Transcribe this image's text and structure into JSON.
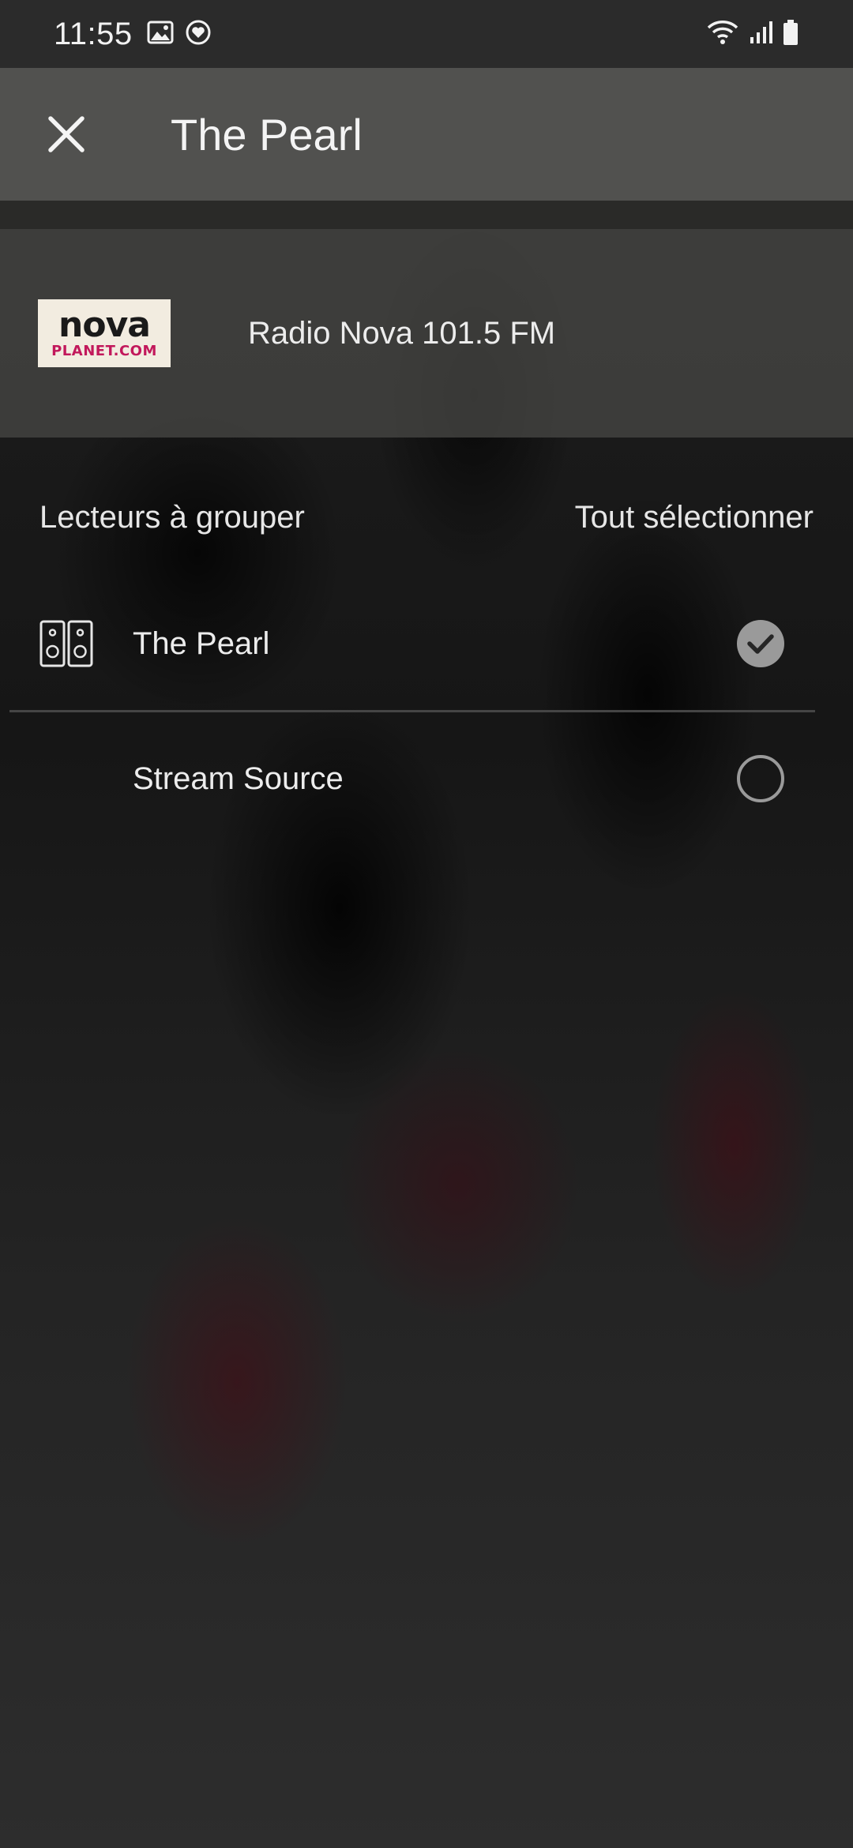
{
  "status_bar": {
    "time": "11:55",
    "left_icons": [
      "image-icon",
      "heart-circle-icon"
    ],
    "right_icons": [
      "wifi-icon",
      "signal-icon",
      "battery-icon"
    ]
  },
  "app_bar": {
    "close_icon": "close-icon",
    "title": "The Pearl"
  },
  "station": {
    "logo_text_top": "nova",
    "logo_text_bottom": "PLANET.COM",
    "name": "Radio Nova 101.5 FM"
  },
  "group_section": {
    "title": "Lecteurs à grouper",
    "select_all_label": "Tout sélectionner"
  },
  "players": [
    {
      "name": "The Pearl",
      "icon": "speakers-icon",
      "selected": true
    },
    {
      "name": "Stream Source",
      "icon": "",
      "selected": false
    }
  ],
  "colors": {
    "app_bar": "#51514f",
    "check_selected": "#9a9a9a",
    "check_unselected_border": "#9a9a9a"
  }
}
